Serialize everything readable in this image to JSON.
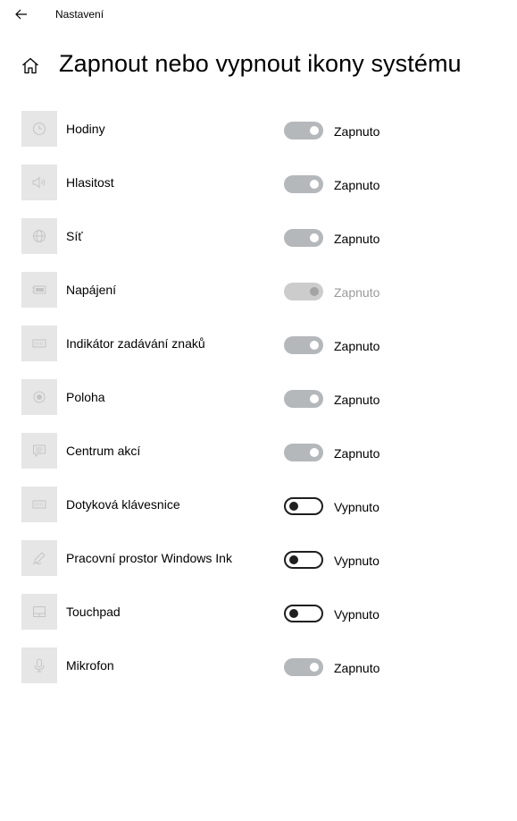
{
  "window": {
    "app_title": "Nastavení",
    "back_icon": "arrow-left-icon"
  },
  "header": {
    "home_icon": "home-icon",
    "title": "Zapnout nebo vypnout ikony systému"
  },
  "items": [
    {
      "label": "Hodiny",
      "icon": "clock-icon",
      "state": "on",
      "state_label": "Zapnuto"
    },
    {
      "label": "Hlasitost",
      "icon": "speaker-icon",
      "state": "on",
      "state_label": "Zapnuto"
    },
    {
      "label": "Síť",
      "icon": "globe-icon",
      "state": "on",
      "state_label": "Zapnuto"
    },
    {
      "label": "Napájení",
      "icon": "battery-icon",
      "state": "disabled",
      "state_label": "Zapnuto"
    },
    {
      "label": "Indikátor zadávání znaků",
      "icon": "keyboard-icon",
      "state": "on",
      "state_label": "Zapnuto"
    },
    {
      "label": "Poloha",
      "icon": "location-icon",
      "state": "on",
      "state_label": "Zapnuto"
    },
    {
      "label": "Centrum akcí",
      "icon": "action-center-icon",
      "state": "on",
      "state_label": "Zapnuto"
    },
    {
      "label": "Dotyková klávesnice",
      "icon": "touch-keyboard-icon",
      "state": "off",
      "state_label": "Vypnuto"
    },
    {
      "label": "Pracovní prostor Windows Ink",
      "icon": "pen-icon",
      "state": "off",
      "state_label": "Vypnuto"
    },
    {
      "label": "Touchpad",
      "icon": "touchpad-icon",
      "state": "off",
      "state_label": "Vypnuto"
    },
    {
      "label": "Mikrofon",
      "icon": "microphone-icon",
      "state": "on",
      "state_label": "Zapnuto"
    }
  ],
  "colors": {
    "icon_tile": "#e6e6e6",
    "toggle_on": "#b5b8bb",
    "toggle_off_border": "#1f1f1f",
    "toggle_disabled": "#cccccc",
    "disabled_text": "#9a9a9a"
  }
}
